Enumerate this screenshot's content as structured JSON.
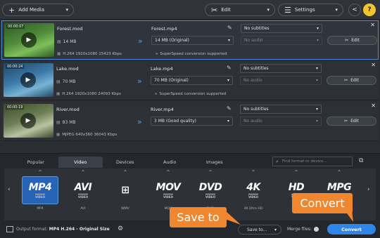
{
  "toolbar": {
    "add_media": "Add Media",
    "edit": "Edit",
    "settings": "Settings"
  },
  "files": [
    {
      "duration": "00:00:07",
      "name": "Forest.mod",
      "size": "14 MB",
      "info": "H.264 1920x1080 15423 Kbps",
      "output_name": "Forest.mp4",
      "output_size": "14 MB (Original)",
      "speed": "SuperSpeed conversion supported",
      "subtitles": "No subtitles",
      "audio": "No audio",
      "edit": "Edit",
      "thumb_colors": [
        "#4f8a3a",
        "#7fbf5a",
        "#2e5a22"
      ]
    },
    {
      "duration": "00:00:24",
      "name": "Lake.mod",
      "size": "70 MB",
      "info": "H.264 1920x1080 24093 Kbps",
      "output_name": "Lake.mp4",
      "output_size": "70 MB (Original)",
      "speed": "SuperSpeed conversion supported",
      "subtitles": "No subtitles",
      "audio": "No audio",
      "edit": "Edit",
      "thumb_colors": [
        "#3c7aa8",
        "#78b4d6",
        "#1f4766"
      ]
    },
    {
      "duration": "00:00:19",
      "name": "River.mod",
      "size": "83 MB",
      "info": "MJPEG 640x360 36043 Kbps",
      "output_name": "River.mp4",
      "output_size": "3 MB (Good quality)",
      "speed": "",
      "subtitles": "No subtitles",
      "audio": "No audio",
      "edit": "Edit",
      "thumb_colors": [
        "#6d7f55",
        "#b8c4a0",
        "#3b4a2c"
      ]
    }
  ],
  "tabs": [
    "Popular",
    "Video",
    "Devices",
    "Audio",
    "Images"
  ],
  "search": {
    "placeholder": "Find format or device..."
  },
  "formats": [
    {
      "big": "MP4",
      "sub": "VIDEO",
      "label": "MP4"
    },
    {
      "big": "AVI",
      "sub": "VIDEO",
      "label": "AVI"
    },
    {
      "big": "⊞",
      "sub": "",
      "label": "WMV"
    },
    {
      "big": "MOV",
      "sub": "VIDEO",
      "label": "MOV"
    },
    {
      "big": "DVD",
      "sub": "VIDEO",
      "label": "DVD"
    },
    {
      "big": "4K",
      "sub": "VIDEO",
      "label": "4K Ultra HD"
    },
    {
      "big": "HD",
      "sub": "VIDEO",
      "label": "HD"
    },
    {
      "big": "MPG",
      "sub": "VIDEO",
      "label": "MPG"
    }
  ],
  "bottom": {
    "output_label": "Output format:",
    "output_value": "MP4 H.264 - Original Size",
    "save_to": "Save to...",
    "merge": "Merge files:",
    "convert": "Convert"
  },
  "callouts": {
    "save_to": "Save to",
    "convert": "Convert"
  },
  "colors": {
    "accent": "#2f86e8",
    "callout": "#f0862e",
    "help": "#f4c430"
  }
}
